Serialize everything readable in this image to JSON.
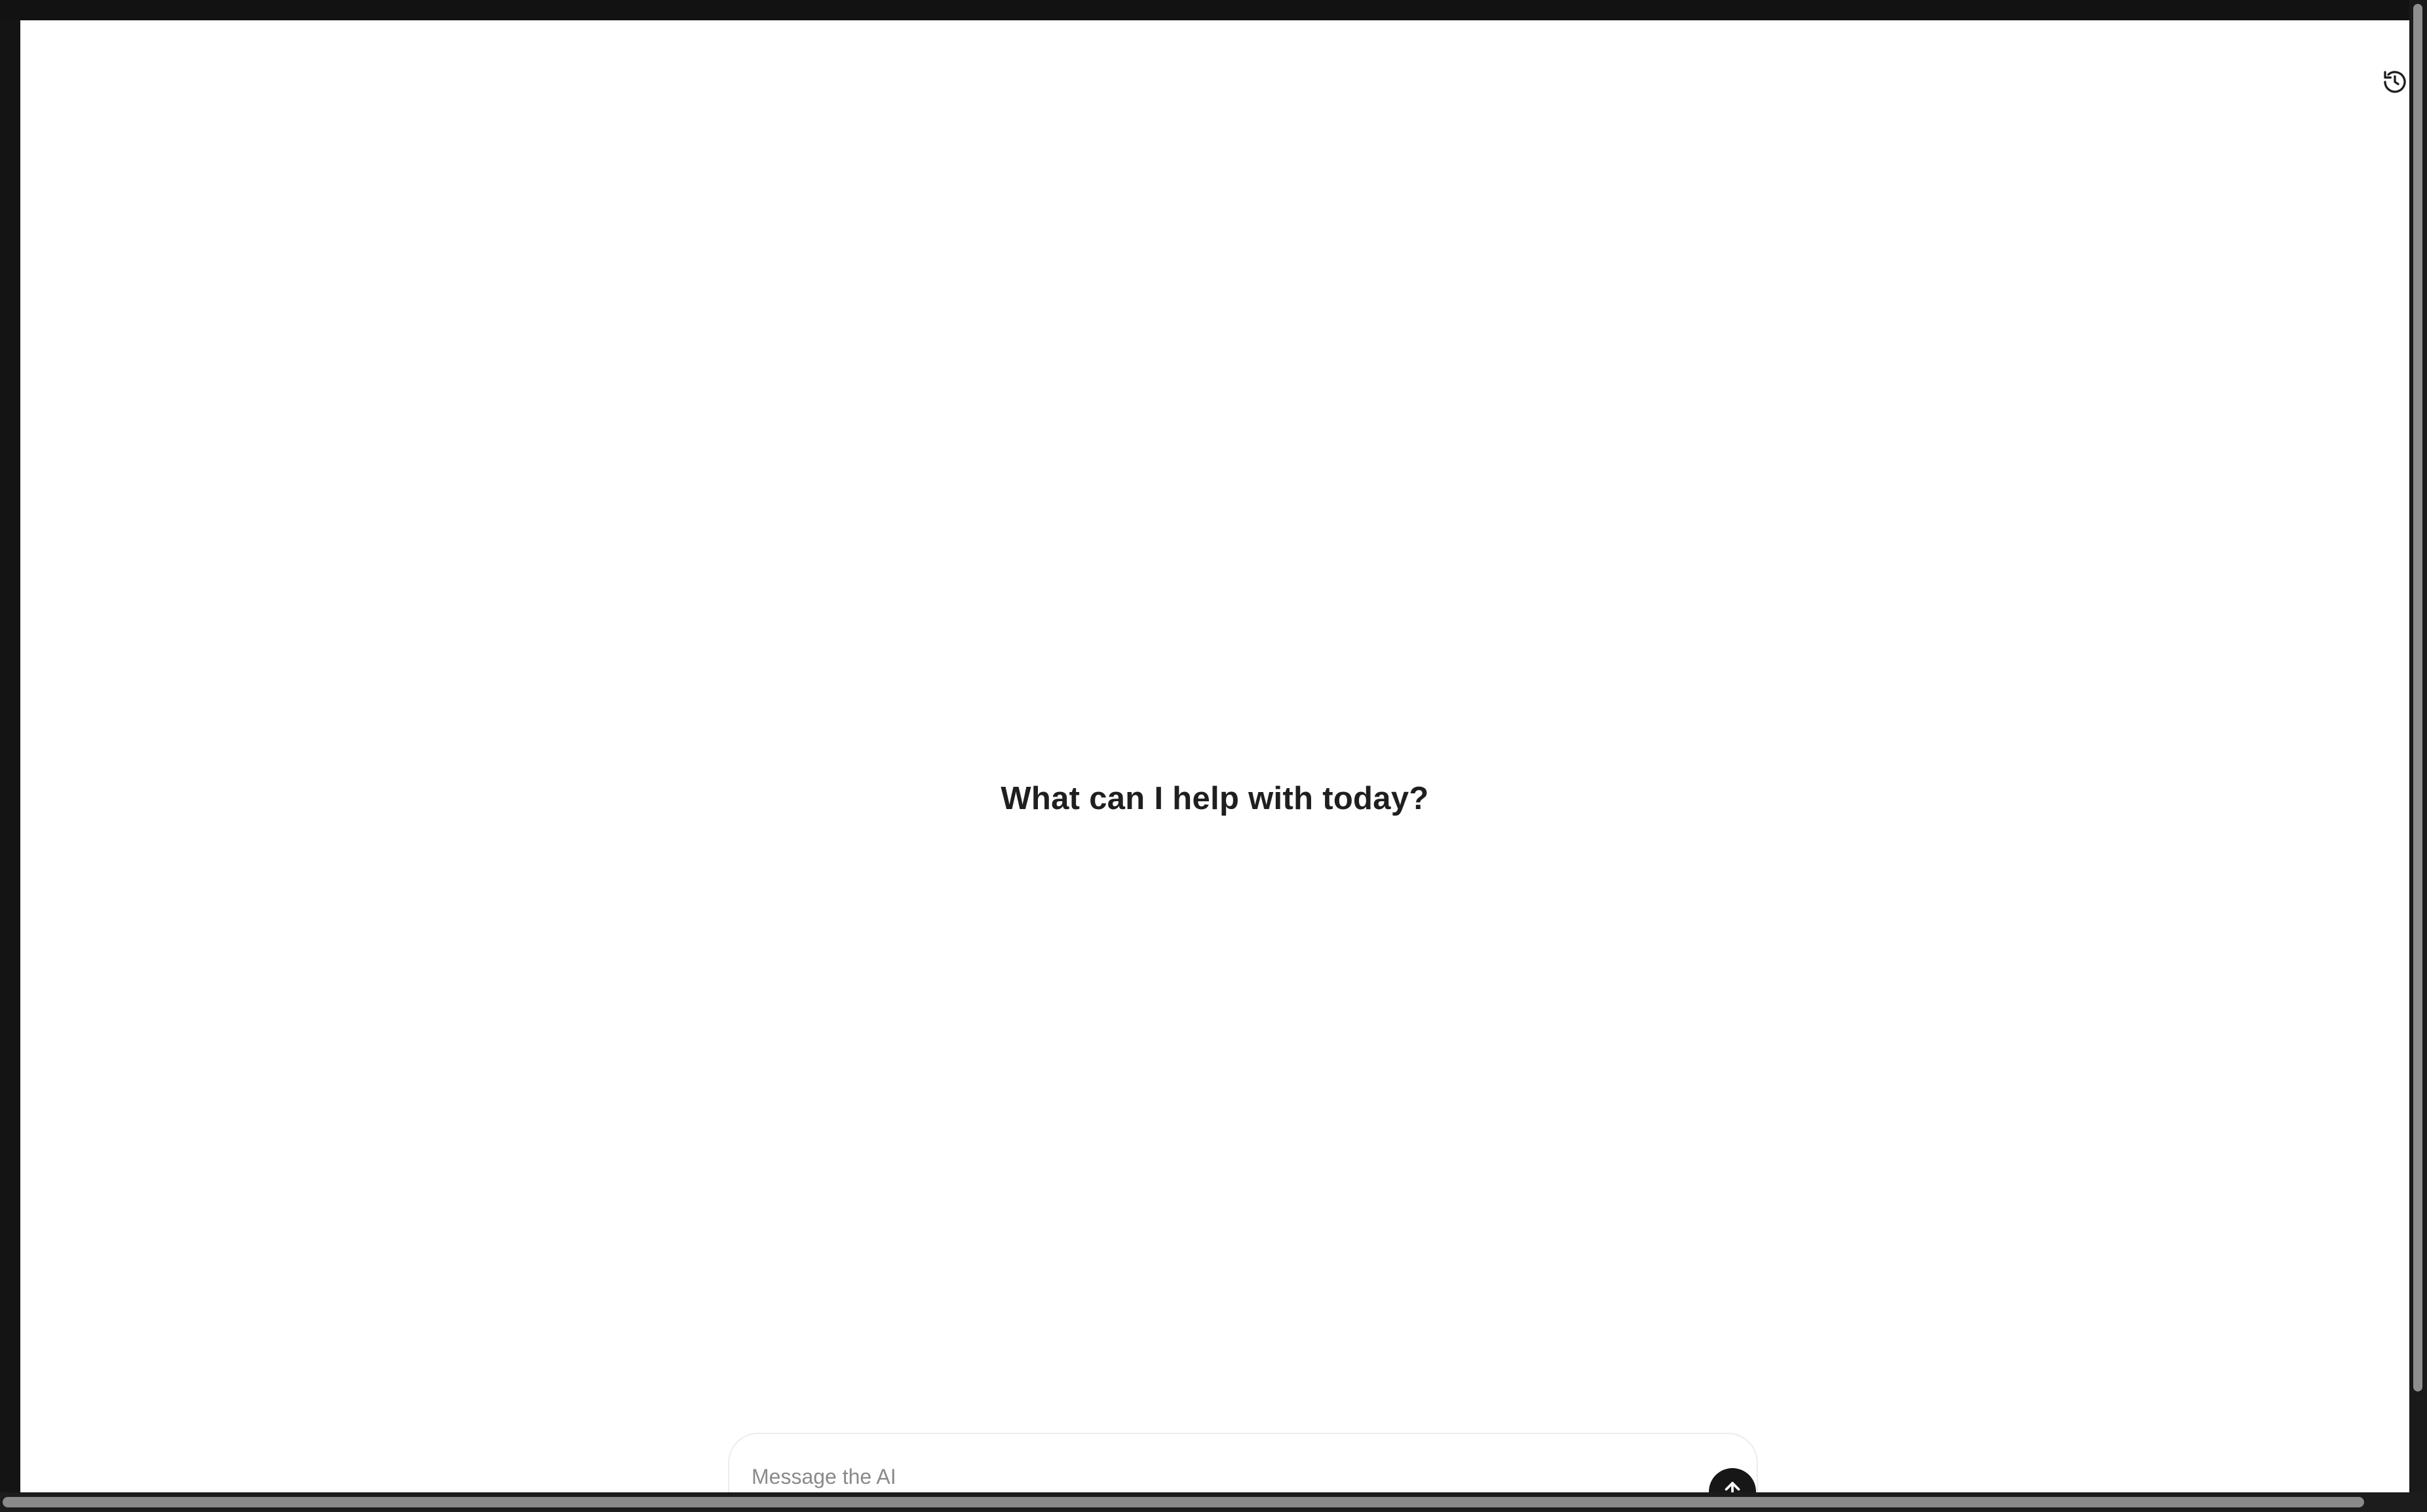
{
  "main": {
    "headline": "What can I help with today?"
  },
  "composer": {
    "placeholder": "Message the AI",
    "value": ""
  },
  "icons": {
    "history": "history-clock-icon",
    "send": "arrow-up-icon"
  },
  "colors": {
    "background": "#ffffff",
    "frame": "#121212",
    "headline": "#1f1f1f",
    "send_button": "#171717",
    "placeholder": "#8a8a8a"
  },
  "scroll": {
    "vertical_thumb_fraction": 0.93,
    "horizontal_thumb_fraction": 0.97
  }
}
